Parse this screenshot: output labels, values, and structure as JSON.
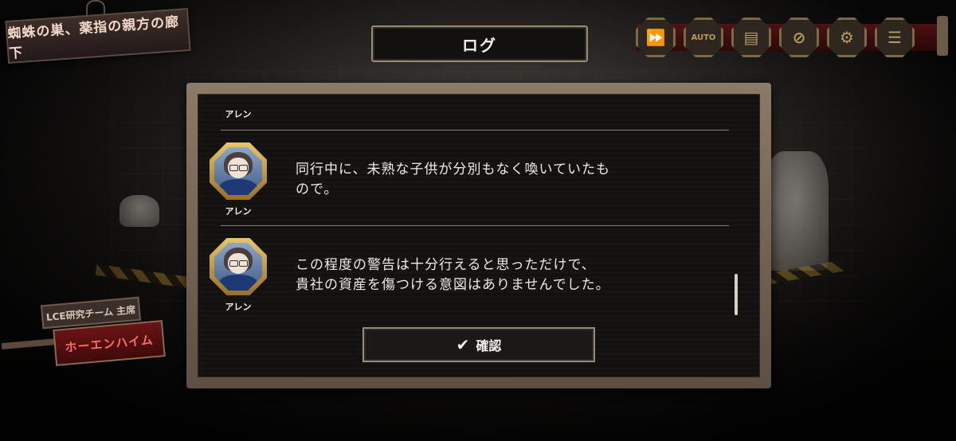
{
  "location": {
    "name": "蜘蛛の巣、薬指の親方の廊下"
  },
  "log": {
    "title": "ログ",
    "confirm_label": "確認"
  },
  "controls": [
    {
      "name": "fast-forward",
      "glyph": "⏩"
    },
    {
      "name": "auto",
      "glyph": "AUTO"
    },
    {
      "name": "log",
      "glyph": "▤"
    },
    {
      "name": "hide-ui",
      "glyph": "⊘"
    },
    {
      "name": "settings",
      "glyph": "⚙"
    },
    {
      "name": "menu",
      "glyph": "☰"
    }
  ],
  "entries": [
    {
      "speaker": "アレン",
      "text": ""
    },
    {
      "speaker": "アレン",
      "text": "同行中に、未熟な子供が分別もなく喚いていたも\nので。"
    },
    {
      "speaker": "アレン",
      "text": "この程度の警告は十分行えると思っただけで、\n貴社の資産を傷つける意図はありませんでした。"
    }
  ],
  "character_plates": {
    "team": "LCE研究チーム 主席",
    "name": "ホーエンハイム"
  }
}
